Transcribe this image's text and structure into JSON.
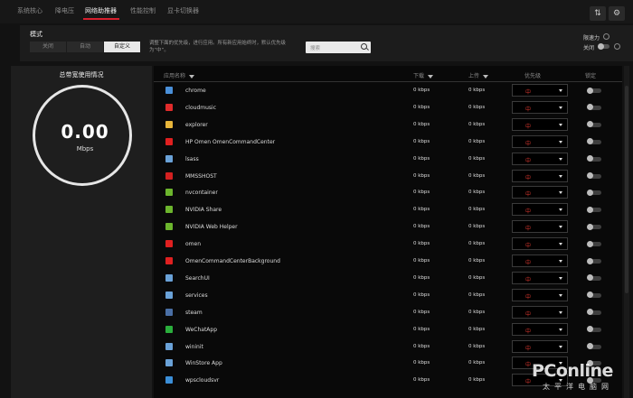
{
  "top_tabs": [
    "系统核心",
    "降电压",
    "网络助推器",
    "性能控制",
    "显卡切换器"
  ],
  "active_tab": "网络助推器",
  "top_buttons": {
    "sort_icon": "sort-icon",
    "settings_icon": "gear-icon"
  },
  "mode": {
    "label": "模式",
    "options": [
      "关闭",
      "自动",
      "自定义"
    ],
    "selected": "自定义",
    "description": "调整下面的优先级，进行应用。所有新应用始终时，默认优先级为“中”。"
  },
  "search": {
    "placeholder": "搜索"
  },
  "right_controls": {
    "label": "限速力",
    "toggle_label": "关闭",
    "toggle_state": "off"
  },
  "bandwidth": {
    "title": "总带宽使用情况",
    "value": "0.00",
    "unit": "Mbps"
  },
  "table": {
    "headers": {
      "app": "应用名称",
      "download": "下载",
      "upload": "上传",
      "priority": "优先级",
      "lock": "锁定"
    },
    "rows": [
      {
        "name": "chrome",
        "icon": "chrome-icon",
        "color": "#4a90d9",
        "dl": "0 kbps",
        "ul": "0 kbps",
        "prio": "中"
      },
      {
        "name": "cloudmusic",
        "icon": "cloudmusic-icon",
        "color": "#e02b2b",
        "dl": "0 kbps",
        "ul": "0 kbps",
        "prio": "中"
      },
      {
        "name": "explorer",
        "icon": "folder-icon",
        "color": "#e8b53a",
        "dl": "0 kbps",
        "ul": "0 kbps",
        "prio": "中"
      },
      {
        "name": "HP Omen OmenCommandCenter",
        "icon": "omen-icon",
        "color": "#e02020",
        "dl": "0 kbps",
        "ul": "0 kbps",
        "prio": "中"
      },
      {
        "name": "lsass",
        "icon": "window-icon",
        "color": "#6aa2d8",
        "dl": "0 kbps",
        "ul": "0 kbps",
        "prio": "中"
      },
      {
        "name": "MMSSHOST",
        "icon": "mmsshost-icon",
        "color": "#d32020",
        "dl": "0 kbps",
        "ul": "0 kbps",
        "prio": "中"
      },
      {
        "name": "nvcontainer",
        "icon": "nvidia-icon",
        "color": "#6cb52d",
        "dl": "0 kbps",
        "ul": "0 kbps",
        "prio": "中"
      },
      {
        "name": "NVIDIA Share",
        "icon": "nvidia-icon",
        "color": "#6cb52d",
        "dl": "0 kbps",
        "ul": "0 kbps",
        "prio": "中"
      },
      {
        "name": "NVIDIA Web Helper",
        "icon": "nvidia-icon",
        "color": "#6cb52d",
        "dl": "0 kbps",
        "ul": "0 kbps",
        "prio": "中"
      },
      {
        "name": "omen",
        "icon": "omen-icon",
        "color": "#e02020",
        "dl": "0 kbps",
        "ul": "0 kbps",
        "prio": "中"
      },
      {
        "name": "OmenCommandCenterBackground",
        "icon": "omen-icon",
        "color": "#e02020",
        "dl": "0 kbps",
        "ul": "0 kbps",
        "prio": "中"
      },
      {
        "name": "SearchUI",
        "icon": "window-icon",
        "color": "#6aa2d8",
        "dl": "0 kbps",
        "ul": "0 kbps",
        "prio": "中"
      },
      {
        "name": "services",
        "icon": "window-icon",
        "color": "#6aa2d8",
        "dl": "0 kbps",
        "ul": "0 kbps",
        "prio": "中"
      },
      {
        "name": "steam",
        "icon": "steam-icon",
        "color": "#4a6fa5",
        "dl": "0 kbps",
        "ul": "0 kbps",
        "prio": "中"
      },
      {
        "name": "WeChatApp",
        "icon": "wechat-icon",
        "color": "#2aae3c",
        "dl": "0 kbps",
        "ul": "0 kbps",
        "prio": "中"
      },
      {
        "name": "wininit",
        "icon": "window-icon",
        "color": "#6aa2d8",
        "dl": "0 kbps",
        "ul": "0 kbps",
        "prio": "中"
      },
      {
        "name": "WinStore App",
        "icon": "window-icon",
        "color": "#6aa2d8",
        "dl": "0 kbps",
        "ul": "0 kbps",
        "prio": "中"
      },
      {
        "name": "wpscloudsvr",
        "icon": "wps-icon",
        "color": "#3b8fd8",
        "dl": "0 kbps",
        "ul": "0 kbps",
        "prio": "中"
      }
    ]
  },
  "watermark": {
    "text": "PConline",
    "sub": "太平洋电脑网"
  },
  "accent": "#d61f2e"
}
